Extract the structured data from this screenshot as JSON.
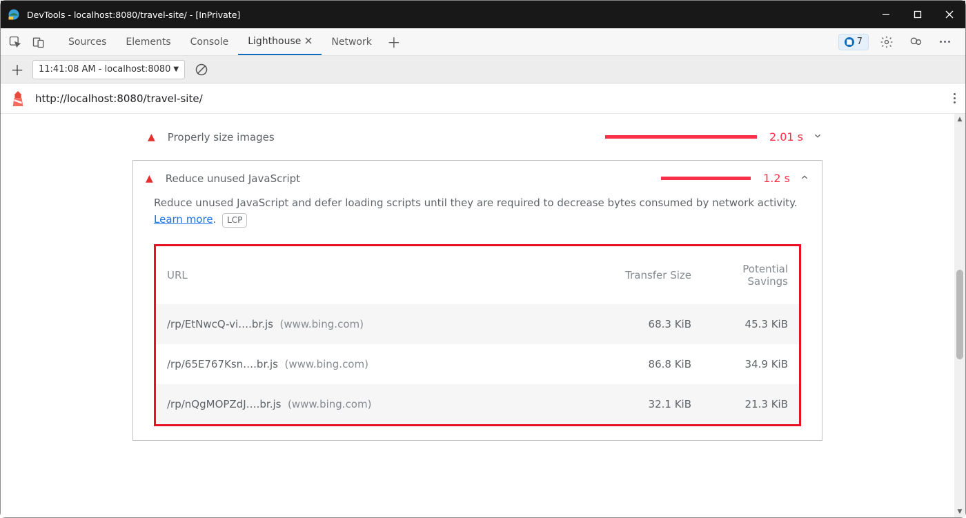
{
  "window": {
    "title": "DevTools - localhost:8080/travel-site/ - [InPrivate]"
  },
  "tabs": {
    "items": [
      "Sources",
      "Elements",
      "Console",
      "Lighthouse",
      "Network"
    ],
    "active_index": 3,
    "issues_count": "7"
  },
  "lh_toolbar": {
    "report_label": "11:41:08 AM - localhost:8080"
  },
  "url_bar": {
    "url": "http://localhost:8080/travel-site/"
  },
  "audits": {
    "first": {
      "title": "Properly size images",
      "time": "2.01 s"
    },
    "expanded": {
      "title": "Reduce unused JavaScript",
      "time": "1.2 s",
      "description_pre": "Reduce unused JavaScript and defer loading scripts until they are required to decrease bytes consumed by network activity. ",
      "learn_more": "Learn more",
      "desc_period": ".",
      "lcp": "LCP",
      "table": {
        "headers": {
          "url": "URL",
          "transfer": "Transfer Size",
          "savings": "Potential Savings"
        },
        "rows": [
          {
            "path": "/rp/EtNwcQ-vi….br.js",
            "host": "(www.bing.com)",
            "transfer": "68.3 KiB",
            "savings": "45.3 KiB"
          },
          {
            "path": "/rp/65E767Ksn….br.js",
            "host": "(www.bing.com)",
            "transfer": "86.8 KiB",
            "savings": "34.9 KiB"
          },
          {
            "path": "/rp/nQgMOPZdJ….br.js",
            "host": "(www.bing.com)",
            "transfer": "32.1 KiB",
            "savings": "21.3 KiB"
          }
        ]
      }
    }
  }
}
